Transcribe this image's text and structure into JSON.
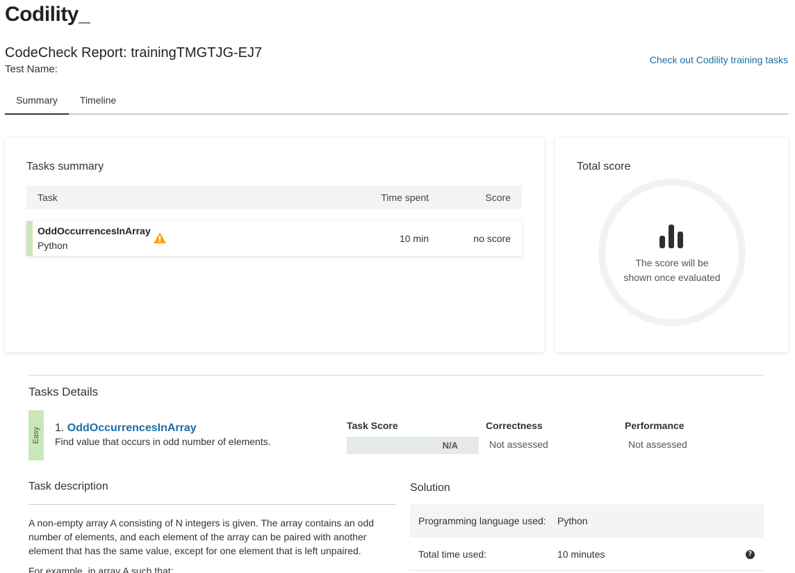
{
  "brand": {
    "logo_text": "Codility",
    "logo_suffix": "_"
  },
  "header": {
    "title": "CodeCheck Report: trainingTMGTJG-EJ7",
    "test_name_label": "Test Name:",
    "training_link": "Check out Codility training tasks"
  },
  "tabs": [
    {
      "label": "Summary",
      "active": true
    },
    {
      "label": "Timeline",
      "active": false
    }
  ],
  "tasks_summary": {
    "title": "Tasks summary",
    "columns": {
      "task": "Task",
      "time": "Time spent",
      "score": "Score"
    },
    "rows": [
      {
        "name": "OddOccurrencesInArray",
        "language": "Python",
        "warning_icon": "warning-triangle",
        "time": "10 min",
        "score": "no score"
      }
    ]
  },
  "total_score": {
    "title": "Total score",
    "icon": "bar-chart-icon",
    "message_line1": "The score will be",
    "message_line2": "shown once evaluated"
  },
  "tasks_details": {
    "title": "Tasks Details",
    "difficulty": "Easy",
    "task_number": "1.",
    "task_name": "OddOccurrencesInArray",
    "task_subtitle": "Find value that occurs in odd number of elements.",
    "task_score_label": "Task Score",
    "task_score_value": "N/A",
    "correctness_label": "Correctness",
    "correctness_value": "Not assessed",
    "performance_label": "Performance",
    "performance_value": "Not assessed"
  },
  "task_description": {
    "title": "Task description",
    "paragraph": "A non-empty array A consisting of N integers is given. The array contains an odd number of elements, and each element of the array can be paired with another element that has the same value, except for one element that is left unpaired.",
    "paragraph2": "For example, in array A such that:"
  },
  "solution": {
    "title": "Solution",
    "language_label": "Programming language used:",
    "language_value": "Python",
    "time_label": "Total time used:",
    "time_value": "10 minutes",
    "help_icon": "question-circle-icon"
  },
  "colors": {
    "accent": "#1c6ea4",
    "easy": "#c9e7b8",
    "warning": "#f5a623"
  }
}
